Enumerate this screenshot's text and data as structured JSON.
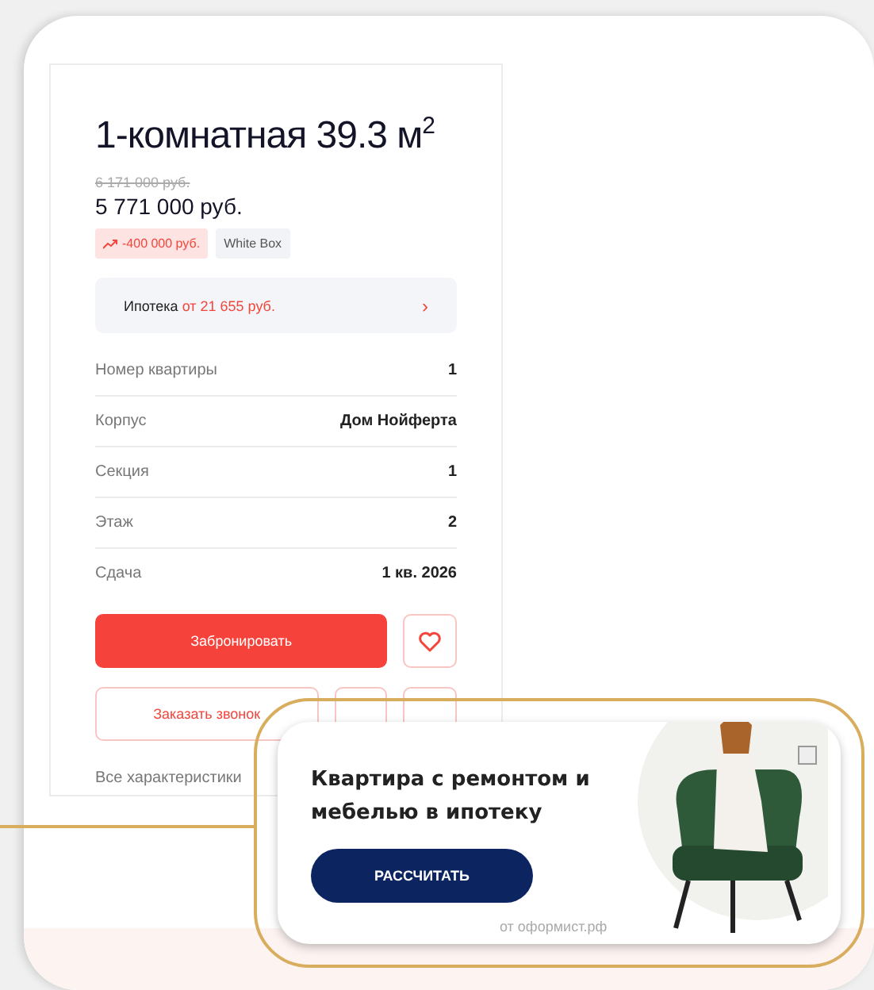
{
  "listing": {
    "title": "1-комнатная 39.3 м$^{2}$",
    "old_price": "6 171 000 руб.",
    "price": "5 771 000 руб.",
    "tags": [
      {
        "kind": "discount",
        "label": "-400 000 руб."
      },
      {
        "kind": "plain",
        "label": "White Box"
      }
    ],
    "mortgage": {
      "label": "Ипотека",
      "amount": "от 21 655 руб.",
      "arrow": "›"
    },
    "specs": [
      {
        "label": "Номер квартиры",
        "value": "1"
      },
      {
        "label": "Корпус",
        "value": "Дом Нойферта"
      },
      {
        "label": "Секция",
        "value": "1"
      },
      {
        "label": "Этаж",
        "value": "2"
      },
      {
        "label": "Сдача",
        "value": "1 кв. 2026"
      }
    ],
    "book_button": "Забронировать",
    "call_button": "Заказать звонок",
    "all_specs_link": "Все характеристики"
  },
  "ad": {
    "title": "Квартира с ремонтом и мебелью в ипотеку",
    "button": "РАССЧИТАТЬ",
    "source": "от оформист.рф"
  }
}
